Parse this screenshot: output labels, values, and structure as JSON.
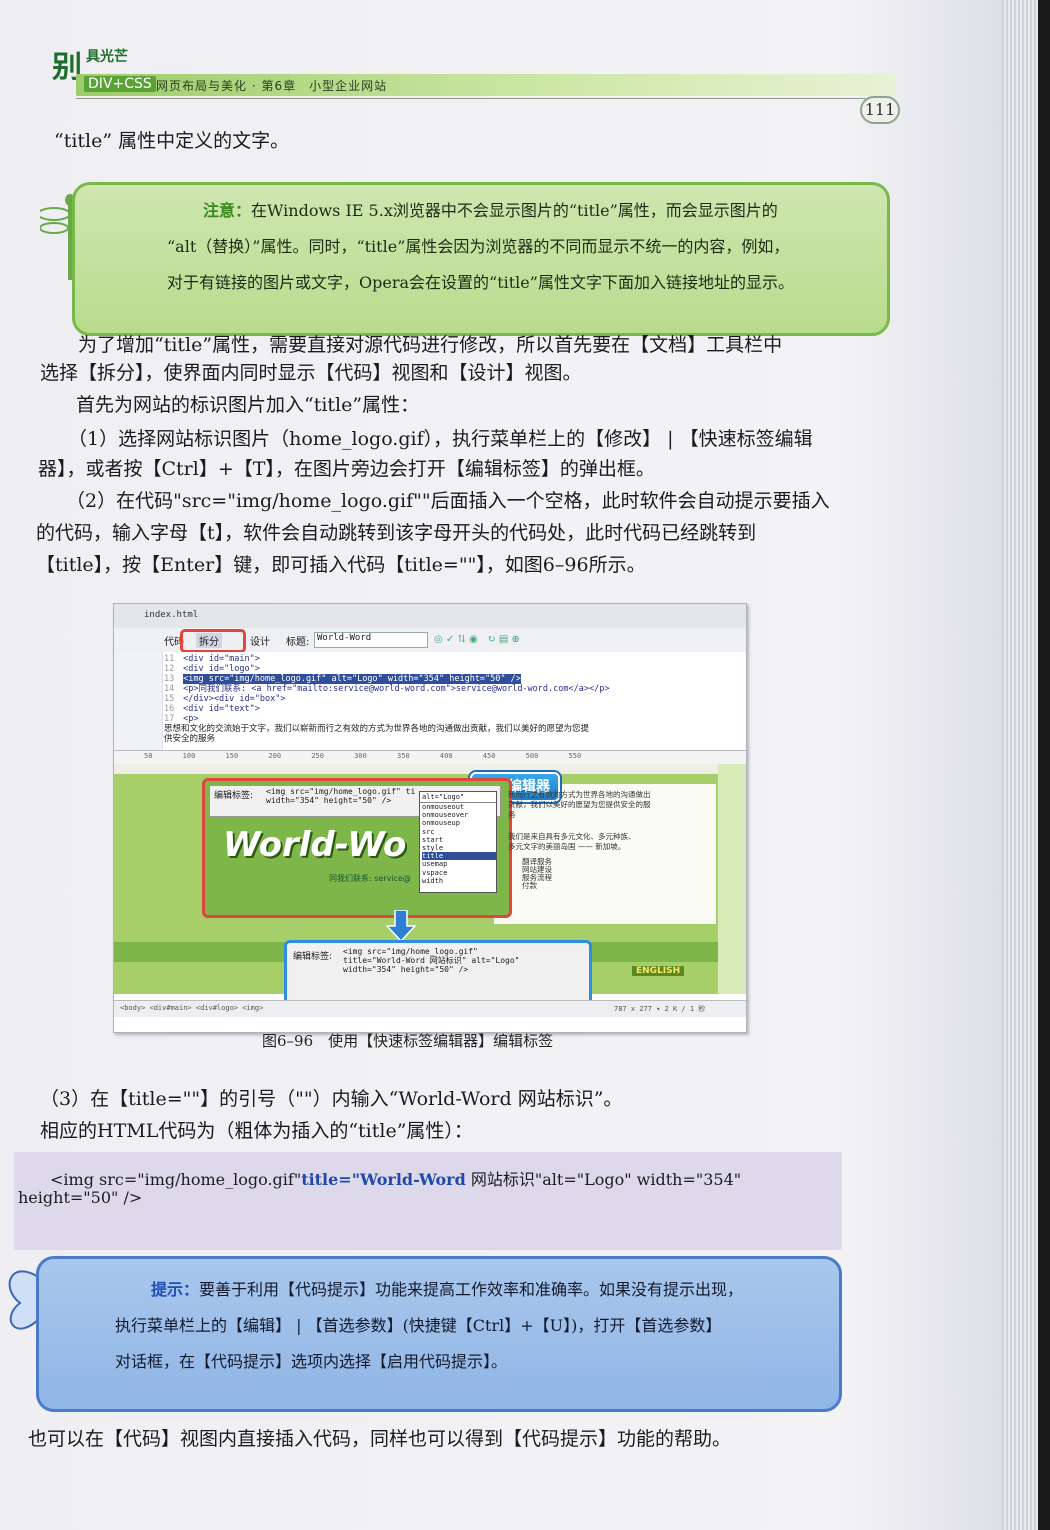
{
  "header": {
    "brand_big": "别",
    "brand_small": "具光芒",
    "series_tag": "DIV+CSS",
    "running_title": "网页布局与美化 · 第6章　小型企业网站",
    "page_number": "111"
  },
  "body": {
    "line0": "“title” 属性中定义的文字。",
    "para1_l1": "为了增加“title”属性，需要直接对源代码进行修改，所以首先要在【文档】工具栏中",
    "para1_l2": "选择【拆分】，使界面内同时显示【代码】视图和【设计】视图。",
    "para2": "首先为网站的标识图片加入“title”属性：",
    "step1_l1": "（1）选择网站标识图片（home_logo.gif），执行菜单栏上的【修改】 | 【快速标签编辑",
    "step1_l2": "器】，或者按【Ctrl】+【T】，在图片旁边会打开【编辑标签】的弹出框。",
    "step2_l1": "（2）在代码\"src=\"img/home_logo.gif\"\"后面插入一个空格，此时软件会自动提示要插入",
    "step2_l2": "的代码，输入字母【t】，软件会自动跳转到该字母开头的代码处，此时代码已经跳转到",
    "step2_l3": "【title】，按【Enter】键，即可插入代码【title=\"\"】，如图6–96所示。",
    "step3_l1": "（3）在【title=\"\"】的引号（\"\"）内输入“World-Word 网站标识”。",
    "step3_l2": "相应的HTML代码为（粗体为插入的“title”属性）：",
    "last_line": "也可以在【代码】视图内直接插入代码，同样也可以得到【代码提示】功能的帮助。"
  },
  "note": {
    "label": "注意：",
    "l1": "在Windows IE 5.x浏览器中不会显示图片的“title”属性，而会显示图片的",
    "l2": "“alt（替换）”属性。同时，“title”属性会因为浏览器的不同而显示不统一的内容，例如，",
    "l3": "对于有链接的图片或文字，Opera会在设置的“title”属性文字下面加入链接地址的显示。"
  },
  "code": {
    "part1": "<img src=\"img/home_logo.gif\"",
    "part_bold": "title=\"World-Word",
    "part2": " 网站标识\"alt=\"Logo\" width=\"354\"",
    "line2": "height=\"50\" />"
  },
  "tip": {
    "label": "提示：",
    "l1": "要善于利用【代码提示】功能来提高工作效率和准确率。如果没有提示出现，",
    "l2": "执行菜单栏上的【编辑】 | 【首选参数】(快捷键【Ctrl】+【U】)，打开【首选参数】",
    "l3": "对话框，在【代码提示】选项内选择【启用代码提示】。"
  },
  "figure": {
    "caption": "图6–96　使用【快速标签编辑器】编辑标签",
    "tab": "index.html",
    "toolbar": {
      "code": "代码",
      "split": "拆分",
      "design": "设计",
      "title_label": "标题:",
      "title_value": "World-Word"
    },
    "code_lines": [
      {
        "n": "11",
        "text": "<div id=\"main\">"
      },
      {
        "n": "12",
        "text": "  <div id=\"logo\">"
      },
      {
        "n": "13",
        "text": "    <img src=\"img/home_logo.gif\" alt=\"Logo\" width=\"354\" height=\"50\" />"
      },
      {
        "n": "14",
        "text": "    <p>同我们联系: <a href=\"mailto:service@world-word.com\">service@world-word.com</a></p>"
      },
      {
        "n": "15",
        "text": "  </div><div id=\"box\">"
      },
      {
        "n": "16",
        "text": "    <div id=\"text\">"
      },
      {
        "n": "17",
        "text": "      <p>"
      }
    ],
    "design_text_line": "思想和文化的交流始于文字，我们以崭新而行之有效的方式为世界各地的沟通做出贡献，我们以美好的愿望为您提",
    "design_text_line2": "供安全的服务",
    "ruler": [
      "50",
      "100",
      "150",
      "200",
      "250",
      "300",
      "350",
      "400",
      "450",
      "500",
      "550"
    ],
    "callout": "标签编辑器",
    "edit_label": "编辑标签:",
    "edit_value_1": "<img src=\"img/home_logo.gif\" ti",
    "edit_value_2": "width=\"354\" height=\"50\" />",
    "autocomplete_input": "alt=\"Logo\"",
    "autocomplete": [
      "onmouseout",
      "onmouseover",
      "onmouseup",
      "src",
      "start",
      "style",
      "title",
      "usemap",
      "vspace",
      "width"
    ],
    "autocomplete_selected": "title",
    "logo_text": "World-Wo",
    "contact_text": "同我们联系: service@",
    "right_text_1": "新而行之有效的方式为世界各地的沟通做出",
    "right_text_2": "贡献，我们以美好的愿望为您提供安全的服",
    "right_text_3": "务",
    "right_text_4": "我们是来自具有多元文化、多元种族、",
    "right_text_5": "多元文字的美丽岛国 —— 新加坡。",
    "bullets": [
      "翻译服务",
      "网站建设",
      "服务流程",
      "付款"
    ],
    "english_btn": "ENGLISH",
    "edit2_value_1": "<img src=\"img/home_logo.gif\"",
    "edit2_value_2": "title=\"World-Word 网站标识\" alt=\"Logo\"",
    "edit2_value_3": "width=\"354\" height=\"50\" />",
    "status_path": "<body> <div#main> <div#logo> <img>",
    "status_info": "787 x 277 ▾ 2 K / 1 秒"
  }
}
